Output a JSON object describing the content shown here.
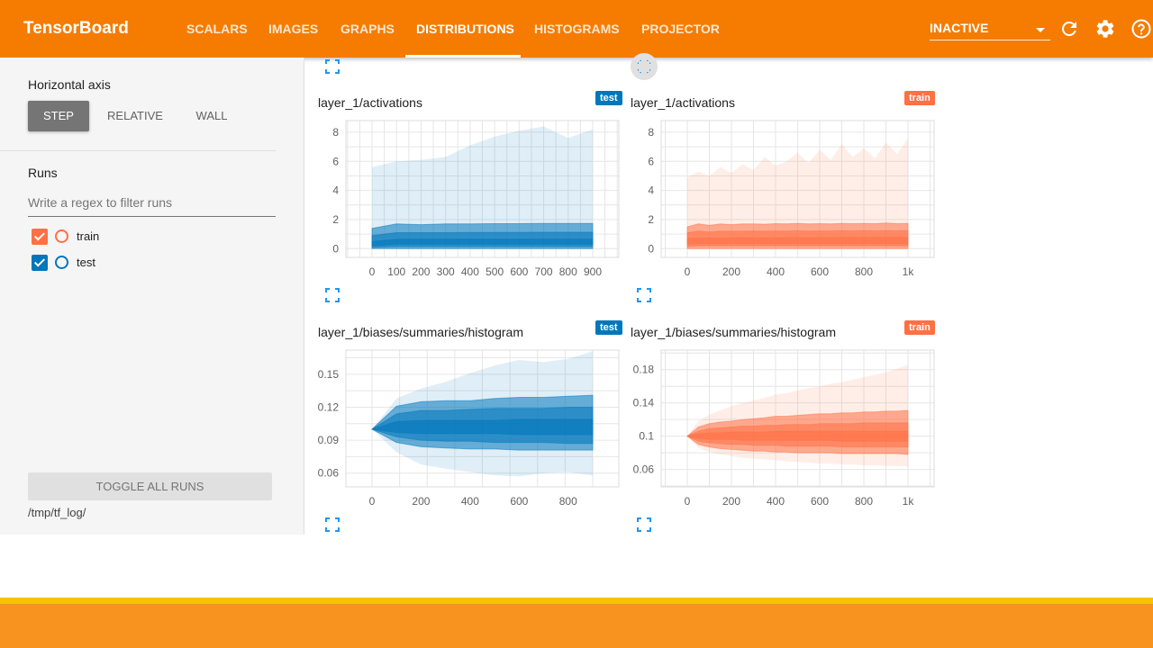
{
  "header": {
    "brand": "TensorBoard",
    "tabs": [
      {
        "label": "SCALARS"
      },
      {
        "label": "IMAGES"
      },
      {
        "label": "GRAPHS"
      },
      {
        "label": "DISTRIBUTIONS",
        "active": true
      },
      {
        "label": "HISTOGRAMS"
      },
      {
        "label": "PROJECTOR"
      }
    ],
    "status_select": "INACTIVE",
    "icons": [
      "refresh-icon",
      "settings-gear-icon",
      "help-icon"
    ],
    "color": "#f57c00"
  },
  "sidebar": {
    "horizontal_axis_label": "Horizontal axis",
    "axis_options": [
      "STEP",
      "RELATIVE",
      "WALL"
    ],
    "axis_selected": "STEP",
    "runs_label": "Runs",
    "filter_placeholder": "Write a regex to filter runs",
    "runs": [
      {
        "name": "train",
        "checked": true,
        "color": "#ff7043"
      },
      {
        "name": "test",
        "checked": true,
        "color": "#0077bb"
      }
    ],
    "toggle_all_label": "TOGGLE ALL RUNS",
    "logdir": "/tmp/tf_log/"
  },
  "cards": [
    {
      "title": "layer_1/activations",
      "run": "test"
    },
    {
      "title": "layer_1/activations",
      "run": "train"
    },
    {
      "title": "layer_1/biases/summaries/histogram",
      "run": "test"
    },
    {
      "title": "layer_1/biases/summaries/histogram",
      "run": "train"
    }
  ],
  "chart_data": [
    {
      "type": "area",
      "title": "layer_1/activations",
      "run": "test",
      "color": "#0077bb",
      "x_ticks": [
        "0",
        "100",
        "200",
        "300",
        "400",
        "500",
        "600",
        "700",
        "800",
        "900"
      ],
      "y_ticks": [
        "0",
        "2",
        "4",
        "6",
        "8"
      ],
      "xlim": [
        0,
        900
      ],
      "ylim": [
        -0.6,
        8.8
      ],
      "x": [
        0,
        100,
        200,
        300,
        400,
        500,
        600,
        700,
        800,
        900
      ],
      "bands": [
        {
          "lower": [
            0,
            0,
            0,
            0,
            0,
            0,
            0,
            0,
            0,
            0
          ],
          "upper": [
            5.6,
            6.0,
            6.1,
            6.3,
            7.1,
            7.7,
            8.1,
            8.4,
            7.6,
            8.2
          ],
          "opacity": 0.12
        },
        {
          "lower": [
            0,
            0,
            0,
            0,
            0,
            0,
            0,
            0,
            0,
            0
          ],
          "upper": [
            1.4,
            1.7,
            1.65,
            1.7,
            1.7,
            1.72,
            1.72,
            1.74,
            1.74,
            1.74
          ],
          "opacity": 0.55
        },
        {
          "lower": [
            0.1,
            0.15,
            0.15,
            0.15,
            0.15,
            0.15,
            0.15,
            0.15,
            0.15,
            0.15
          ],
          "upper": [
            0.9,
            1.1,
            1.1,
            1.1,
            1.12,
            1.12,
            1.12,
            1.13,
            1.13,
            1.13
          ],
          "opacity": 0.55
        },
        {
          "lower": [
            0.2,
            0.3,
            0.3,
            0.3,
            0.3,
            0.3,
            0.3,
            0.3,
            0.3,
            0.3
          ],
          "upper": [
            0.5,
            0.65,
            0.65,
            0.65,
            0.66,
            0.66,
            0.66,
            0.66,
            0.66,
            0.66
          ],
          "opacity": 0.6
        }
      ]
    },
    {
      "type": "area",
      "title": "layer_1/activations",
      "run": "train",
      "color": "#ff7043",
      "x_ticks": [
        "0",
        "200",
        "400",
        "600",
        "800",
        "1k"
      ],
      "y_ticks": [
        "0",
        "2",
        "4",
        "6",
        "8"
      ],
      "xlim": [
        0,
        1000
      ],
      "ylim": [
        -0.6,
        8.8
      ],
      "x": [
        0,
        50,
        100,
        150,
        200,
        250,
        300,
        350,
        400,
        450,
        500,
        550,
        600,
        650,
        700,
        750,
        800,
        850,
        900,
        950,
        1000
      ],
      "bands": [
        {
          "lower": [
            0,
            0,
            0,
            0,
            0,
            0,
            0,
            0,
            0,
            0,
            0,
            0,
            0,
            0,
            0,
            0,
            0,
            0,
            0,
            0,
            0
          ],
          "upper": [
            4.9,
            5.3,
            5.0,
            5.6,
            5.2,
            5.8,
            5.4,
            6.3,
            5.7,
            6.0,
            6.6,
            5.9,
            6.8,
            6.1,
            7.2,
            6.3,
            6.9,
            6.2,
            7.3,
            6.5,
            7.6
          ],
          "opacity": 0.12
        },
        {
          "lower": [
            0,
            0,
            0,
            0,
            0,
            0,
            0,
            0,
            0,
            0,
            0,
            0,
            0,
            0,
            0,
            0,
            0,
            0,
            0,
            0,
            0
          ],
          "upper": [
            1.5,
            1.7,
            1.6,
            1.7,
            1.65,
            1.7,
            1.7,
            1.68,
            1.72,
            1.7,
            1.74,
            1.7,
            1.72,
            1.7,
            1.74,
            1.72,
            1.74,
            1.72,
            1.76,
            1.72,
            1.74
          ],
          "opacity": 0.55
        },
        {
          "lower": [
            0.15,
            0.2,
            0.2,
            0.2,
            0.2,
            0.2,
            0.2,
            0.2,
            0.2,
            0.2,
            0.2,
            0.2,
            0.2,
            0.2,
            0.2,
            0.2,
            0.2,
            0.2,
            0.2,
            0.2,
            0.2
          ],
          "upper": [
            1.1,
            1.2,
            1.15,
            1.2,
            1.2,
            1.2,
            1.22,
            1.2,
            1.22,
            1.2,
            1.23,
            1.2,
            1.22,
            1.22,
            1.23,
            1.22,
            1.24,
            1.22,
            1.24,
            1.22,
            1.24
          ],
          "opacity": 0.55
        },
        {
          "lower": [
            0.3,
            0.35,
            0.35,
            0.35,
            0.35,
            0.35,
            0.35,
            0.35,
            0.35,
            0.35,
            0.35,
            0.35,
            0.35,
            0.35,
            0.35,
            0.35,
            0.35,
            0.35,
            0.35,
            0.35,
            0.35
          ],
          "upper": [
            0.7,
            0.75,
            0.75,
            0.75,
            0.75,
            0.76,
            0.76,
            0.76,
            0.76,
            0.76,
            0.77,
            0.76,
            0.77,
            0.76,
            0.77,
            0.77,
            0.77,
            0.77,
            0.78,
            0.77,
            0.78
          ],
          "opacity": 0.6
        }
      ]
    },
    {
      "type": "area",
      "title": "layer_1/biases/summaries/histogram",
      "run": "test",
      "color": "#0077bb",
      "x_ticks": [
        "0",
        "200",
        "400",
        "600",
        "800"
      ],
      "y_ticks": [
        "0.06",
        "0.09",
        "0.12",
        "0.15"
      ],
      "xlim": [
        0,
        900
      ],
      "ylim": [
        0.0475,
        0.172
      ],
      "x": [
        0,
        100,
        200,
        300,
        400,
        500,
        600,
        700,
        800,
        900
      ],
      "bands": [
        {
          "lower": [
            0.1,
            0.079,
            0.068,
            0.064,
            0.061,
            0.058,
            0.057,
            0.06,
            0.061,
            0.058
          ],
          "upper": [
            0.1,
            0.128,
            0.137,
            0.143,
            0.151,
            0.158,
            0.163,
            0.161,
            0.164,
            0.171
          ],
          "opacity": 0.12
        },
        {
          "lower": [
            0.1,
            0.088,
            0.084,
            0.083,
            0.082,
            0.082,
            0.081,
            0.081,
            0.081,
            0.081
          ],
          "upper": [
            0.1,
            0.121,
            0.125,
            0.126,
            0.126,
            0.128,
            0.129,
            0.129,
            0.13,
            0.131
          ],
          "opacity": 0.55
        },
        {
          "lower": [
            0.1,
            0.093,
            0.09,
            0.089,
            0.089,
            0.088,
            0.088,
            0.088,
            0.087,
            0.087
          ],
          "upper": [
            0.1,
            0.114,
            0.117,
            0.117,
            0.118,
            0.119,
            0.119,
            0.119,
            0.12,
            0.12
          ],
          "opacity": 0.55
        },
        {
          "lower": [
            0.1,
            0.097,
            0.096,
            0.096,
            0.096,
            0.096,
            0.095,
            0.095,
            0.095,
            0.095
          ],
          "upper": [
            0.1,
            0.107,
            0.108,
            0.108,
            0.108,
            0.108,
            0.109,
            0.109,
            0.109,
            0.109
          ],
          "opacity": 0.6
        }
      ]
    },
    {
      "type": "area",
      "title": "layer_1/biases/summaries/histogram",
      "run": "train",
      "color": "#ff7043",
      "x_ticks": [
        "0",
        "200",
        "400",
        "600",
        "800",
        "1k"
      ],
      "y_ticks": [
        "0.06",
        "0.1",
        "0.14",
        "0.18"
      ],
      "xlim": [
        0,
        1000
      ],
      "ylim": [
        0.039,
        0.2035
      ],
      "x": [
        0,
        50,
        100,
        150,
        200,
        250,
        300,
        350,
        400,
        450,
        500,
        550,
        600,
        650,
        700,
        750,
        800,
        850,
        900,
        950,
        1000
      ],
      "bands": [
        {
          "lower": [
            0.1,
            0.086,
            0.081,
            0.078,
            0.076,
            0.074,
            0.073,
            0.072,
            0.071,
            0.07,
            0.069,
            0.068,
            0.067,
            0.067,
            0.066,
            0.066,
            0.065,
            0.065,
            0.064,
            0.064,
            0.064
          ],
          "upper": [
            0.1,
            0.118,
            0.126,
            0.131,
            0.136,
            0.14,
            0.143,
            0.146,
            0.15,
            0.152,
            0.155,
            0.158,
            0.16,
            0.163,
            0.165,
            0.168,
            0.171,
            0.174,
            0.177,
            0.181,
            0.186
          ],
          "opacity": 0.12
        },
        {
          "lower": [
            0.1,
            0.09,
            0.087,
            0.085,
            0.084,
            0.083,
            0.082,
            0.082,
            0.081,
            0.081,
            0.08,
            0.08,
            0.08,
            0.08,
            0.079,
            0.079,
            0.079,
            0.079,
            0.079,
            0.079,
            0.078
          ],
          "upper": [
            0.1,
            0.111,
            0.115,
            0.117,
            0.118,
            0.12,
            0.121,
            0.122,
            0.124,
            0.124,
            0.125,
            0.126,
            0.127,
            0.127,
            0.128,
            0.128,
            0.129,
            0.129,
            0.13,
            0.13,
            0.131
          ],
          "opacity": 0.55
        },
        {
          "lower": [
            0.1,
            0.094,
            0.092,
            0.091,
            0.09,
            0.09,
            0.089,
            0.089,
            0.089,
            0.088,
            0.088,
            0.088,
            0.088,
            0.088,
            0.087,
            0.087,
            0.087,
            0.087,
            0.087,
            0.087,
            0.087
          ],
          "upper": [
            0.1,
            0.106,
            0.109,
            0.11,
            0.111,
            0.112,
            0.112,
            0.113,
            0.113,
            0.114,
            0.114,
            0.114,
            0.115,
            0.115,
            0.115,
            0.115,
            0.116,
            0.116,
            0.116,
            0.116,
            0.116
          ],
          "opacity": 0.55
        },
        {
          "lower": [
            0.1,
            0.097,
            0.096,
            0.096,
            0.096,
            0.095,
            0.095,
            0.095,
            0.095,
            0.095,
            0.095,
            0.095,
            0.095,
            0.095,
            0.094,
            0.094,
            0.094,
            0.094,
            0.094,
            0.094,
            0.094
          ],
          "upper": [
            0.1,
            0.103,
            0.104,
            0.104,
            0.105,
            0.105,
            0.105,
            0.105,
            0.106,
            0.106,
            0.106,
            0.106,
            0.106,
            0.106,
            0.106,
            0.106,
            0.106,
            0.106,
            0.106,
            0.106,
            0.106
          ],
          "opacity": 0.6
        }
      ]
    }
  ]
}
